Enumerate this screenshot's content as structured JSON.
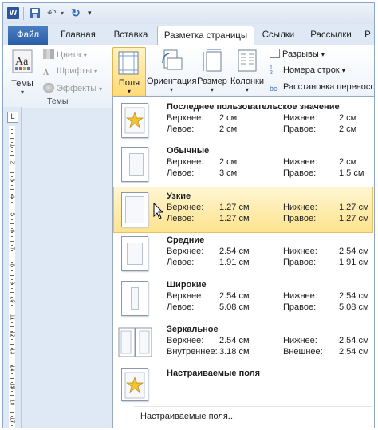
{
  "qat": {
    "word_letter": "W"
  },
  "tabs": [
    {
      "label": "Файл"
    },
    {
      "label": "Главная"
    },
    {
      "label": "Вставка"
    },
    {
      "label": "Разметка страницы"
    },
    {
      "label": "Ссылки"
    },
    {
      "label": "Рассылки"
    },
    {
      "label": "Р"
    }
  ],
  "ribbon": {
    "themes": {
      "big_label": "Темы",
      "colors_label": "Цвета",
      "fonts_label": "Шрифты",
      "effects_label": "Эффекты",
      "group_label": "Темы"
    },
    "page_setup": {
      "margins_label": "Поля",
      "orientation_label": "Ориентация",
      "size_label": "Размер",
      "columns_label": "Колонки",
      "breaks_label": "Разрывы",
      "line_numbers_label": "Номера строк",
      "hyphenation_label": "Расстановка переносов"
    }
  },
  "ruler": {
    "corner_glyph": "L",
    "numbers": [
      "1",
      "2",
      "3",
      "4",
      "5",
      "6",
      "7",
      "8",
      "9",
      "10",
      "11",
      "12",
      "13",
      "14",
      "15",
      "16",
      "17"
    ]
  },
  "margins_menu": {
    "options": [
      {
        "title": "Последнее пользовательское значение",
        "icon": "star-icon",
        "rows": [
          {
            "l1": "Верхнее:",
            "v1": "2 см",
            "l2": "Нижнее:",
            "v2": "2 см"
          },
          {
            "l1": "Левое:",
            "v1": "2 см",
            "l2": "Правое:",
            "v2": "2 см"
          }
        ]
      },
      {
        "title": "Обычные",
        "icon": "margins-normal-icon",
        "rows": [
          {
            "l1": "Верхнее:",
            "v1": "2 см",
            "l2": "Нижнее:",
            "v2": "2 см"
          },
          {
            "l1": "Левое:",
            "v1": "3 см",
            "l2": "Правое:",
            "v2": "1.5 см"
          }
        ]
      },
      {
        "title": "Узкие",
        "icon": "margins-narrow-icon",
        "highlighted": true,
        "rows": [
          {
            "l1": "Верхнее:",
            "v1": "1.27 см",
            "l2": "Нижнее:",
            "v2": "1.27 см"
          },
          {
            "l1": "Левое:",
            "v1": "1.27 см",
            "l2": "Правое:",
            "v2": "1.27 см"
          }
        ]
      },
      {
        "title": "Средние",
        "icon": "margins-moderate-icon",
        "rows": [
          {
            "l1": "Верхнее:",
            "v1": "2.54 см",
            "l2": "Нижнее:",
            "v2": "2.54 см"
          },
          {
            "l1": "Левое:",
            "v1": "1.91 см",
            "l2": "Правое:",
            "v2": "1.91 см"
          }
        ]
      },
      {
        "title": "Широкие",
        "icon": "margins-wide-icon",
        "rows": [
          {
            "l1": "Верхнее:",
            "v1": "2.54 см",
            "l2": "Нижнее:",
            "v2": "2.54 см"
          },
          {
            "l1": "Левое:",
            "v1": "5.08 см",
            "l2": "Правое:",
            "v2": "5.08 см"
          }
        ]
      },
      {
        "title": "Зеркальное",
        "icon": "margins-mirrored-icon",
        "rows": [
          {
            "l1": "Верхнее:",
            "v1": "2.54 см",
            "l2": "Нижнее:",
            "v2": "2.54 см"
          },
          {
            "l1": "Внутреннее:",
            "v1": "3.18 см",
            "l2": "Внешнее:",
            "v2": "2.54 см"
          }
        ]
      },
      {
        "title": "Настраиваемые поля",
        "icon": "star-icon",
        "rows": []
      }
    ],
    "custom_link": "Настраиваемые поля...",
    "custom_link_accel": "Н"
  }
}
